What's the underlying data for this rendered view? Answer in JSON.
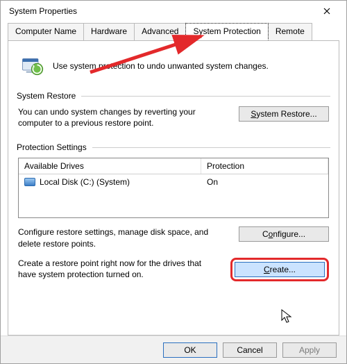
{
  "window": {
    "title": "System Properties"
  },
  "tabs": {
    "computer_name": "Computer Name",
    "hardware": "Hardware",
    "advanced": "Advanced",
    "system_protection": "System Protection",
    "remote": "Remote"
  },
  "intro": {
    "text": "Use system protection to undo unwanted system changes."
  },
  "system_restore": {
    "group_title": "System Restore",
    "description": "You can undo system changes by reverting your computer to a previous restore point.",
    "button_label": "System Restore...",
    "button_mnemonic": "S"
  },
  "protection_settings": {
    "group_title": "Protection Settings",
    "headers": {
      "drives": "Available Drives",
      "protection": "Protection"
    },
    "rows": [
      {
        "drive": "Local Disk (C:) (System)",
        "protection": "On"
      }
    ],
    "configure": {
      "description": "Configure restore settings, manage disk space, and delete restore points.",
      "button_label": "Configure...",
      "button_mnemonic": "o"
    },
    "create": {
      "description": "Create a restore point right now for the drives that have system protection turned on.",
      "button_label": "Create...",
      "button_mnemonic": "C"
    }
  },
  "footer": {
    "ok": "OK",
    "cancel": "Cancel",
    "apply": "Apply"
  },
  "annotations": {
    "arrow_points_to_tab": "system_protection",
    "highlighted_button": "create"
  }
}
